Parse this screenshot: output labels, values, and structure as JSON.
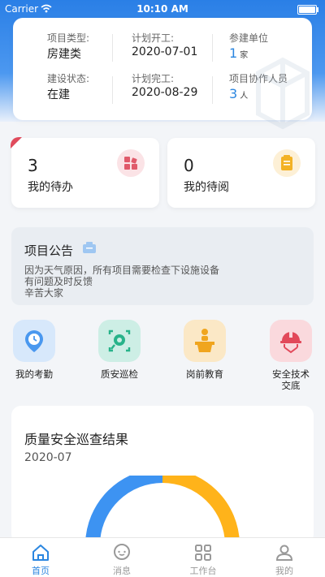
{
  "status_bar": {
    "carrier": "Carrier",
    "time": "10:10 AM"
  },
  "project_info": {
    "type_label": "项目类型:",
    "type_value": "房建类",
    "plan_start_label": "计划开工:",
    "plan_start_value": "2020-07-01",
    "units_label": "参建单位",
    "units_count": "1",
    "units_unit": "家",
    "status_label": "建设状态:",
    "status_value": "在建",
    "plan_end_label": "计划完工:",
    "plan_end_value": "2020-08-29",
    "members_label": "项目协作人员",
    "members_count": "3",
    "members_unit": "人"
  },
  "todo": {
    "count": "3",
    "label": "我的待办"
  },
  "to_read": {
    "count": "0",
    "label": "我的待阅"
  },
  "notice": {
    "title": "项目公告",
    "lines": [
      "因为天气原因，所有项目需要检查下设施设备",
      "有问题及时反馈",
      "辛苦大家"
    ]
  },
  "quick_actions": [
    {
      "label": "我的考勤",
      "icon": "clock-pin-icon"
    },
    {
      "label": "质安巡检",
      "icon": "inspection-scan-icon"
    },
    {
      "label": "岗前教育",
      "icon": "lecture-podium-icon"
    },
    {
      "label": "安全技术交底",
      "label_line1": "安全技术",
      "label_line2": "交底",
      "icon": "safety-helmet-icon"
    }
  ],
  "result": {
    "title": "质量安全巡查结果",
    "date": "2020-07"
  },
  "colors": {
    "accent": "#2a86e0",
    "orange": "#ffb31a",
    "blue_ring": "#3d93f2"
  },
  "tabs": [
    {
      "label": "首页",
      "icon": "home-icon",
      "active": true
    },
    {
      "label": "消息",
      "icon": "message-icon",
      "active": false
    },
    {
      "label": "工作台",
      "icon": "grid-icon",
      "active": false
    },
    {
      "label": "我的",
      "icon": "user-icon",
      "active": false
    }
  ]
}
